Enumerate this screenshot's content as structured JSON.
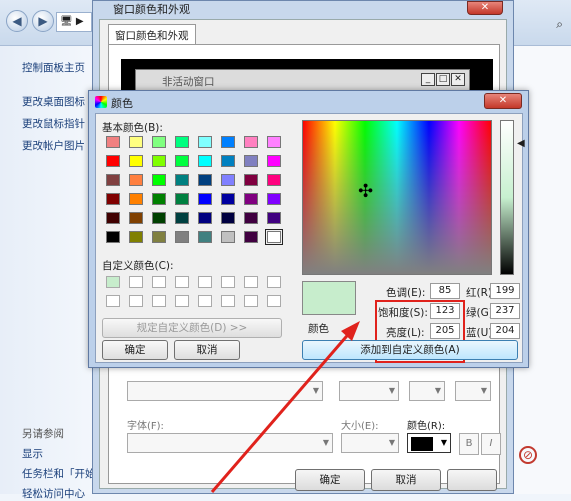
{
  "control_panel": {
    "nav_back": "◀",
    "nav_forward": "▶",
    "address_icon": "🖥 ▶",
    "side_links": [
      "控制面板主页",
      "更改桌面图标",
      "更改鼠标指针",
      "更改帐户图片"
    ],
    "see_also": "另请参阅",
    "bottom_links": [
      "显示",
      "任务栏和「开始",
      "轻松访问中心"
    ]
  },
  "window_color_dialog": {
    "title": "窗口颜色和外观",
    "tab": "窗口颜色和外观",
    "inactive_window_title": "非活动窗口",
    "font_label": "字体(F):",
    "size_label": "大小(E):",
    "color_label": "颜色(R):",
    "bold_label": "B",
    "italic_label": "I",
    "ok": "确定",
    "cancel": "取消"
  },
  "color_dialog": {
    "title": "颜色",
    "basic_colors_label": "基本颜色(B):",
    "custom_colors_label": "自定义颜色(C):",
    "define_custom_button": "规定自定义颜色(D) >>",
    "ok": "确定",
    "cancel": "取消",
    "preview_label": "颜色",
    "add_custom_button": "添加到自定义颜色(A)",
    "hue_label": "色调(E):",
    "hue": "85",
    "sat_label": "饱和度(S):",
    "sat": "123",
    "lum_label": "亮度(L):",
    "lum": "205",
    "red_label": "红(R):",
    "red": "199",
    "green_label": "绿(G):",
    "green": "237",
    "blue_label": "蓝(U):",
    "blue": "204",
    "selected_color": "#c7edcc",
    "basic_colors": [
      "#f08080",
      "#ffff80",
      "#80ff80",
      "#00ff80",
      "#80ffff",
      "#0080ff",
      "#ff80c0",
      "#ff80ff",
      "#ff0000",
      "#ffff00",
      "#80ff00",
      "#00ff40",
      "#00ffff",
      "#0080c0",
      "#8080c0",
      "#ff00ff",
      "#804040",
      "#ff8040",
      "#00ff00",
      "#008080",
      "#004080",
      "#8080ff",
      "#800040",
      "#ff0080",
      "#800000",
      "#ff8000",
      "#008000",
      "#008040",
      "#0000ff",
      "#0000a0",
      "#800080",
      "#8000ff",
      "#400000",
      "#804000",
      "#004000",
      "#004040",
      "#000080",
      "#000040",
      "#400040",
      "#400080",
      "#000000",
      "#808000",
      "#808040",
      "#808080",
      "#408080",
      "#c0c0c0",
      "#400040",
      "#ffffff"
    ]
  }
}
